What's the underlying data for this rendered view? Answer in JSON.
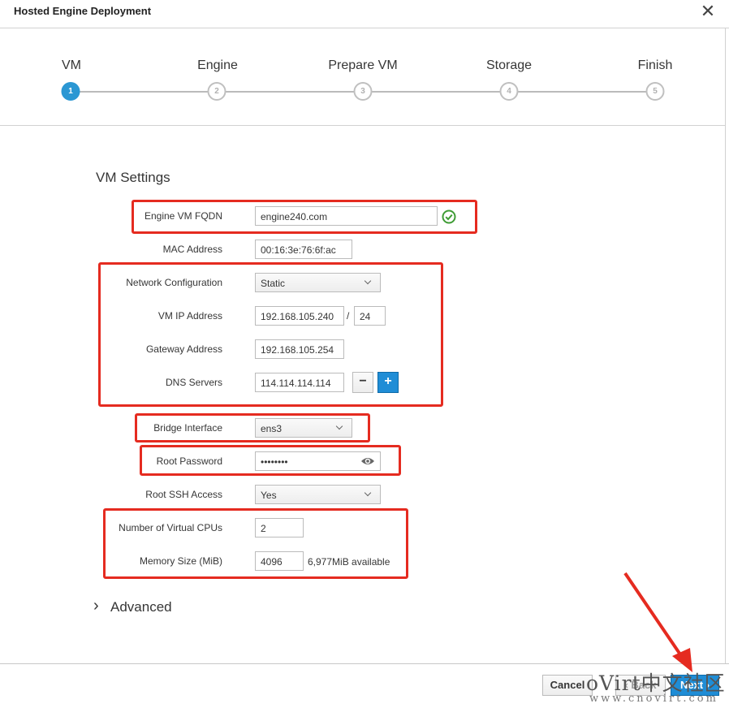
{
  "dialog": {
    "title": "Hosted Engine Deployment",
    "close_glyph": "✕"
  },
  "steps": [
    {
      "label": "VM",
      "number": "1",
      "active": true
    },
    {
      "label": "Engine",
      "number": "2",
      "active": false
    },
    {
      "label": "Prepare VM",
      "number": "3",
      "active": false
    },
    {
      "label": "Storage",
      "number": "4",
      "active": false
    },
    {
      "label": "Finish",
      "number": "5",
      "active": false
    }
  ],
  "section_title": "VM Settings",
  "fields": {
    "fqdn": {
      "label": "Engine VM FQDN",
      "value": "engine240.com",
      "status_icon": "check-circle-icon"
    },
    "mac": {
      "label": "MAC Address",
      "value": "00:16:3e:76:6f:ac"
    },
    "network_config": {
      "label": "Network Configuration",
      "value": "Static"
    },
    "vm_ip": {
      "label": "VM IP Address",
      "value": "192.168.105.240",
      "separator": "/",
      "prefix": "24"
    },
    "gateway": {
      "label": "Gateway Address",
      "value": "192.168.105.254"
    },
    "dns": {
      "label": "DNS Servers",
      "value": "114.114.114.114",
      "minus": "−",
      "plus": "+"
    },
    "bridge": {
      "label": "Bridge Interface",
      "value": "ens3"
    },
    "root_password": {
      "label": "Root Password",
      "value": "••••••••",
      "reveal_icon": "eye-icon"
    },
    "root_ssh": {
      "label": "Root SSH Access",
      "value": "Yes"
    },
    "vcpus": {
      "label": "Number of Virtual CPUs",
      "value": "2"
    },
    "memory": {
      "label": "Memory Size (MiB)",
      "value": "4096",
      "available": "6,977MiB available"
    }
  },
  "advanced": {
    "label": "Advanced",
    "chevron": "›"
  },
  "footer": {
    "cancel": "Cancel",
    "back": "‹ Back",
    "next": "Next ›"
  },
  "watermark": {
    "line1": "oVirt中文社区",
    "line2": "www.cnovirt.com"
  },
  "colors": {
    "accent": "#2b97d3",
    "highlight": "#e52b20",
    "success": "#3f9c35"
  }
}
